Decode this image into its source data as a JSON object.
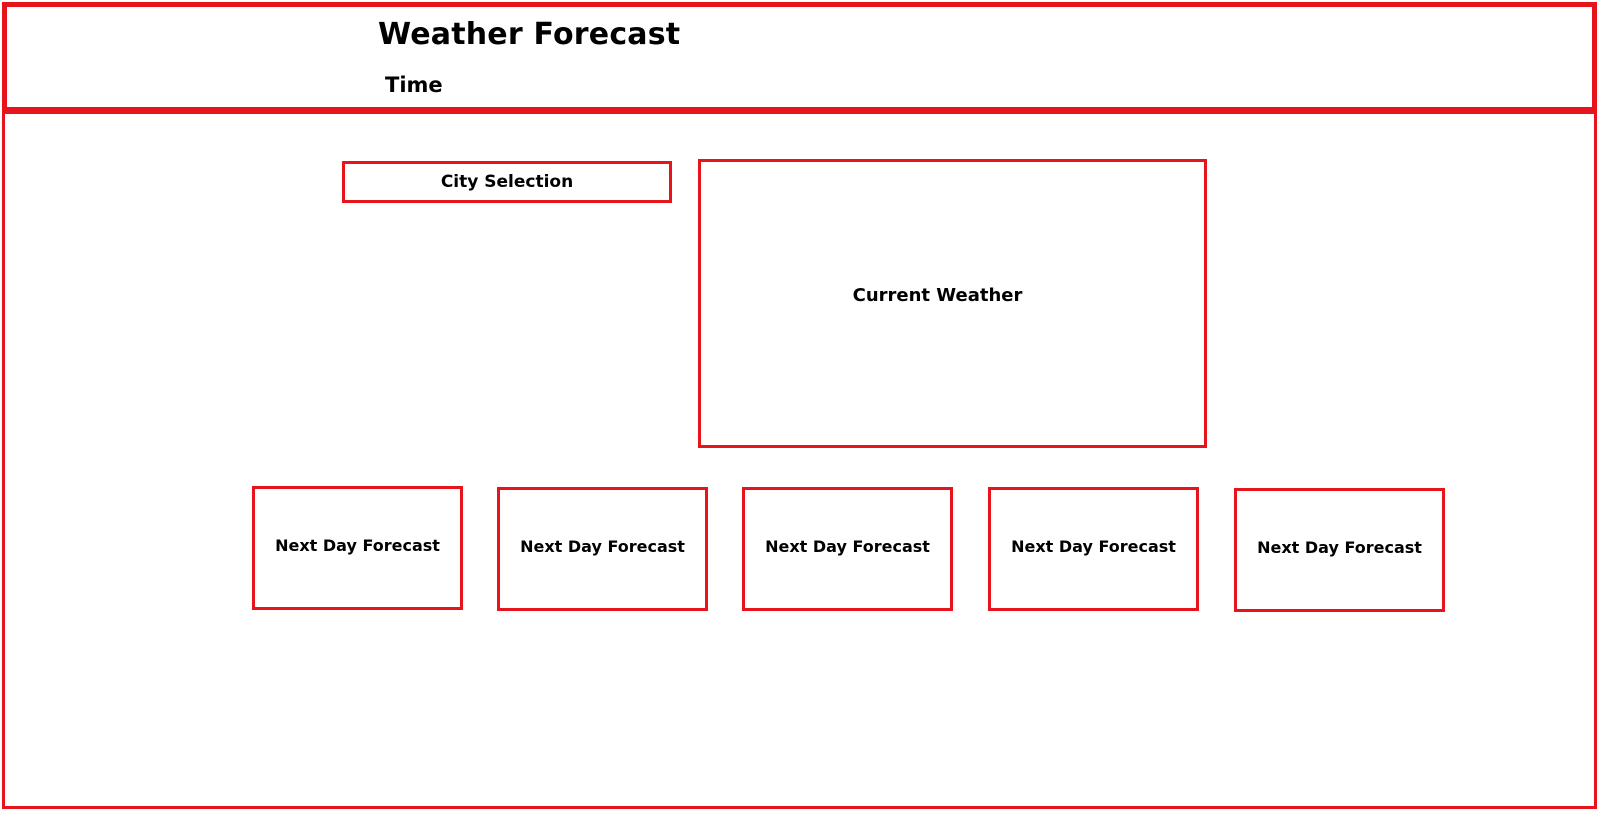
{
  "header": {
    "title": "Weather Forecast",
    "time_label": "Time"
  },
  "main": {
    "city_selection": "City Selection",
    "current_weather": "Current Weather",
    "forecasts": [
      {
        "label": "Next Day Forecast"
      },
      {
        "label": "Next Day Forecast"
      },
      {
        "label": "Next Day Forecast"
      },
      {
        "label": "Next Day Forecast"
      },
      {
        "label": "Next Day Forecast"
      }
    ]
  },
  "colors": {
    "border": "#e8141c",
    "text": "#000000",
    "background": "#ffffff"
  }
}
